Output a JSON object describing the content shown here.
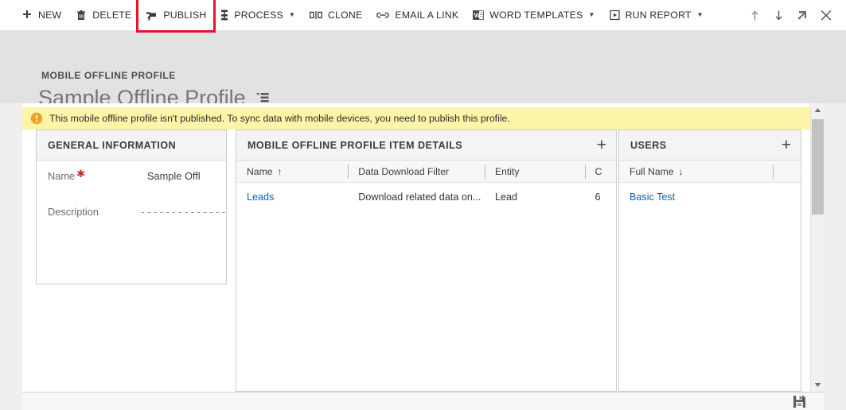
{
  "commandbar": {
    "items": [
      {
        "label": "NEW",
        "icon": "plus-icon",
        "has_caret": false,
        "highlighted": false
      },
      {
        "label": "DELETE",
        "icon": "trash-icon",
        "has_caret": false,
        "highlighted": false
      },
      {
        "label": "PUBLISH",
        "icon": "publish-icon",
        "has_caret": false,
        "highlighted": true
      },
      {
        "label": "PROCESS",
        "icon": "process-icon",
        "has_caret": true,
        "highlighted": false
      },
      {
        "label": "CLONE",
        "icon": "clone-icon",
        "has_caret": false,
        "highlighted": false
      },
      {
        "label": "EMAIL A LINK",
        "icon": "link-icon",
        "has_caret": false,
        "highlighted": false
      },
      {
        "label": "WORD TEMPLATES",
        "icon": "word-icon",
        "has_caret": true,
        "highlighted": false
      },
      {
        "label": "RUN REPORT",
        "icon": "report-icon",
        "has_caret": true,
        "highlighted": false
      }
    ],
    "right_icons": [
      {
        "name": "previous-record-icon",
        "glyph": "↑"
      },
      {
        "name": "next-record-icon",
        "glyph": "↓"
      },
      {
        "name": "popout-icon",
        "glyph": "↗"
      },
      {
        "name": "close-icon",
        "glyph": "✕"
      }
    ],
    "highlight_color": "#e8132b"
  },
  "header": {
    "breadcrumb": "MOBILE OFFLINE PROFILE",
    "record_title": "Sample Offline Profile"
  },
  "notification": {
    "icon": "warning-icon",
    "message": "This mobile offline profile isn't published. To sync data with mobile devices, you need to publish this profile.",
    "background": "#fcf4a7"
  },
  "general_information": {
    "title": "GENERAL INFORMATION",
    "fields": [
      {
        "label": "Name",
        "required": true,
        "value": "Sample Offl"
      },
      {
        "label": "Description",
        "required": false,
        "value": "- - - - - - - - - - - - - - -"
      }
    ]
  },
  "item_details": {
    "title": "MOBILE OFFLINE PROFILE ITEM DETAILS",
    "add_label": "+",
    "columns": [
      {
        "label": "Name",
        "sort": "↑"
      },
      {
        "label": "Data Download Filter",
        "sort": ""
      },
      {
        "label": "Entity",
        "sort": ""
      },
      {
        "label": "C",
        "sort": ""
      }
    ],
    "rows": [
      {
        "name": "Leads",
        "filter": "Download related data on...",
        "entity": "Lead",
        "created": "6"
      }
    ]
  },
  "users": {
    "title": "USERS",
    "add_label": "+",
    "columns": [
      {
        "label": "Full Name",
        "sort": "↓"
      },
      {
        "label": "",
        "sort": ""
      }
    ],
    "rows": [
      {
        "full_name": "Basic Test"
      }
    ]
  },
  "scrollbar": {
    "up_arrow": "▲",
    "down_arrow": "▼"
  },
  "footer": {
    "save_icon": "save-icon"
  }
}
